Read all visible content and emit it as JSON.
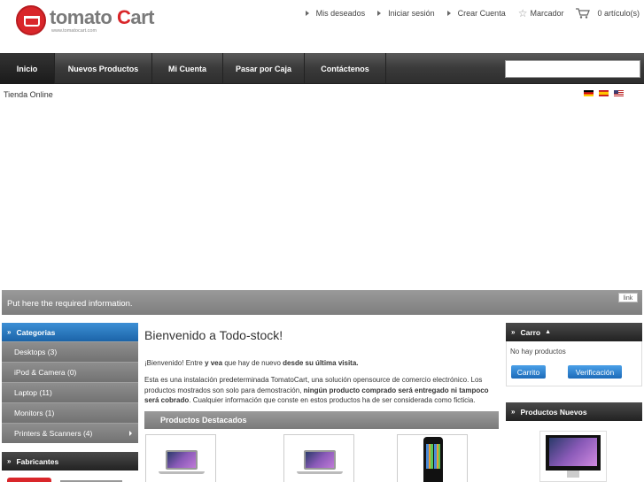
{
  "header": {
    "logo_text_a": "tomato ",
    "logo_text_b": "C",
    "logo_text_c": "art",
    "logo_url": "www.tomatocart.com",
    "links": {
      "wishlist": "Mis deseados",
      "login": "Iniciar sesión",
      "create_account": "Crear Cuenta",
      "bookmark": "Marcador",
      "cart": "0 artículo(s)"
    }
  },
  "nav": {
    "items": [
      "Inicio",
      "Nuevos Productos",
      "Mi Cuenta",
      "Pasar por Caja",
      "Contáctenos"
    ],
    "active_index": 0,
    "search_value": ""
  },
  "breadcrumb": "Tienda Online",
  "languages": [
    "de",
    "es",
    "en"
  ],
  "info_bar": {
    "text": "Put here the required information.",
    "link": "link"
  },
  "categories": {
    "title": "Categorias",
    "items": [
      {
        "label": "Desktops (3)"
      },
      {
        "label": "iPod & Camera (0)"
      },
      {
        "label": "Laptop (11)"
      },
      {
        "label": "Monitors (1)"
      },
      {
        "label": "Printers & Scanners (4)"
      }
    ]
  },
  "manufacturers": {
    "title": "Fabricantes"
  },
  "main": {
    "title": "Bienvenido a Todo-stock!",
    "greeting_a": "¡Bienvenido!",
    "greeting_b": " Entre ",
    "greeting_c": "y vea",
    "greeting_d": " que hay de nuevo ",
    "greeting_e": "desde su última visita.",
    "desc_a": "Esta es una instalación predeterminada TomatoCart, una solución opensource de comercio electrónico. Los productos mostrados son solo para demostración, ",
    "desc_b": "ningún producto comprado será entregado ni tampoco será cobrado",
    "desc_c": ". Cualquier información que conste en estos productos ha de ser considerada como ficticia.",
    "featured_title": "Productos Destacados"
  },
  "cart_box": {
    "title": "Carro",
    "empty": "No hay productos",
    "cart_button": "Carrito",
    "checkout_button": "Verificación"
  },
  "new_products": {
    "title": "Productos Nuevos"
  },
  "colors": {
    "brand_red": "#d9262a",
    "nav_dark": "#2e2e2e",
    "accent_blue": "#1c64a8"
  }
}
